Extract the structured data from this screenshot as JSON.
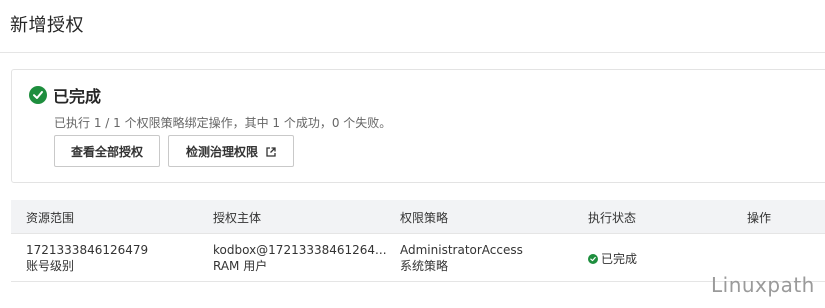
{
  "page": {
    "title": "新增授权"
  },
  "result": {
    "status_title": "已完成",
    "description": "已执行 1 / 1 个权限策略绑定操作，其中 1 个成功，0 个失败。",
    "status_icon": "check-circle-icon",
    "view_all_button": "查看全部授权",
    "check_button": "检测治理权限",
    "external_icon": "external-link-icon"
  },
  "table": {
    "headers": [
      "资源范围",
      "授权主体",
      "权限策略",
      "执行状态",
      "操作"
    ],
    "rows": [
      {
        "scope": "1721333846126479",
        "scope_level": "账号级别",
        "principal": "kodbox@17213338461264...",
        "principal_type": "RAM 用户",
        "policy": "AdministratorAccess",
        "policy_type": "系统策略",
        "state": "已完成",
        "action": ""
      }
    ]
  },
  "watermark": "Linuxpath",
  "colors": {
    "success": "#1e8e3e",
    "header_bg": "#f2f3f5"
  }
}
